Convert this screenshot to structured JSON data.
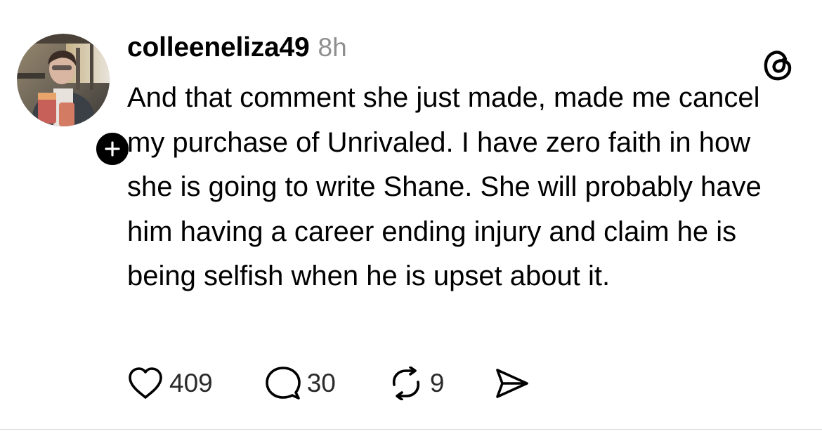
{
  "post": {
    "username": "colleeneliza49",
    "time": "8h",
    "text": "And that comment she just made, made me cancel my purchase of Unrivaled. I have zero faith in how she is going to write Shane. She will probably have him having a career ending injury and claim he is being selfish when he is upset about it.",
    "avatar_icon": "user-photo",
    "follow_icon": "plus-icon",
    "brand_icon": "threads-logo"
  },
  "actions": {
    "likes": "409",
    "replies": "30",
    "reposts": "9"
  },
  "colors": {
    "text": "#000000",
    "muted": "#8f8f8f",
    "divider": "#dbdbdb",
    "badge": "#000000"
  }
}
